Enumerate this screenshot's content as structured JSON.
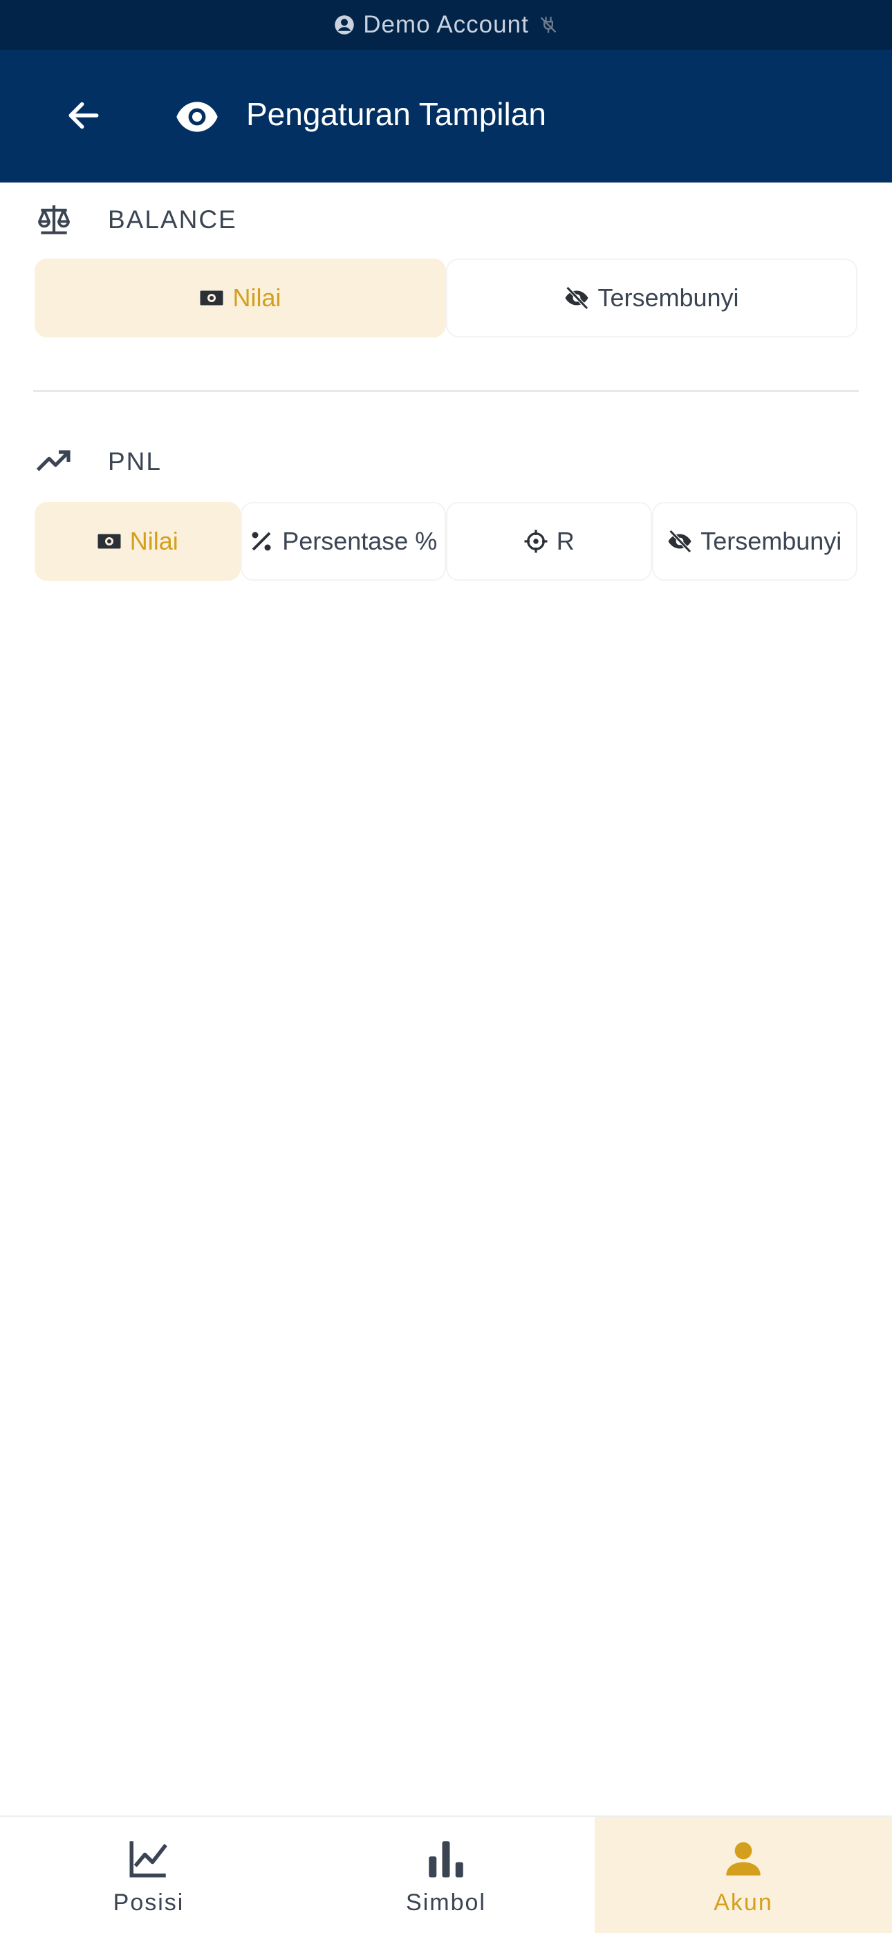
{
  "banner": {
    "label": "Demo Account"
  },
  "header": {
    "title": "Pengaturan Tampilan"
  },
  "balance": {
    "label": "BALANCE",
    "options": [
      {
        "label": "Nilai",
        "icon": "money-icon",
        "selected": true
      },
      {
        "label": "Tersembunyi",
        "icon": "eye-off-icon",
        "selected": false
      }
    ]
  },
  "pnl": {
    "label": "PNL",
    "options": [
      {
        "label": "Nilai",
        "icon": "money-icon",
        "selected": true
      },
      {
        "label": "Persentase %",
        "icon": "percent-icon",
        "selected": false
      },
      {
        "label": "R",
        "icon": "crosshair-icon",
        "selected": false
      },
      {
        "label": "Tersembunyi",
        "icon": "eye-off-icon",
        "selected": false
      }
    ]
  },
  "bottom_nav": {
    "items": [
      {
        "label": "Posisi",
        "icon": "line-chart-icon",
        "active": false
      },
      {
        "label": "Simbol",
        "icon": "bar-chart-icon",
        "active": false
      },
      {
        "label": "Akun",
        "icon": "person-icon",
        "active": true
      }
    ]
  },
  "colors": {
    "banner_bg": "#022448",
    "header_bg": "#023062",
    "accent": "#d49f1c",
    "accent_bg": "#faf0dc",
    "text": "#3b4452"
  }
}
